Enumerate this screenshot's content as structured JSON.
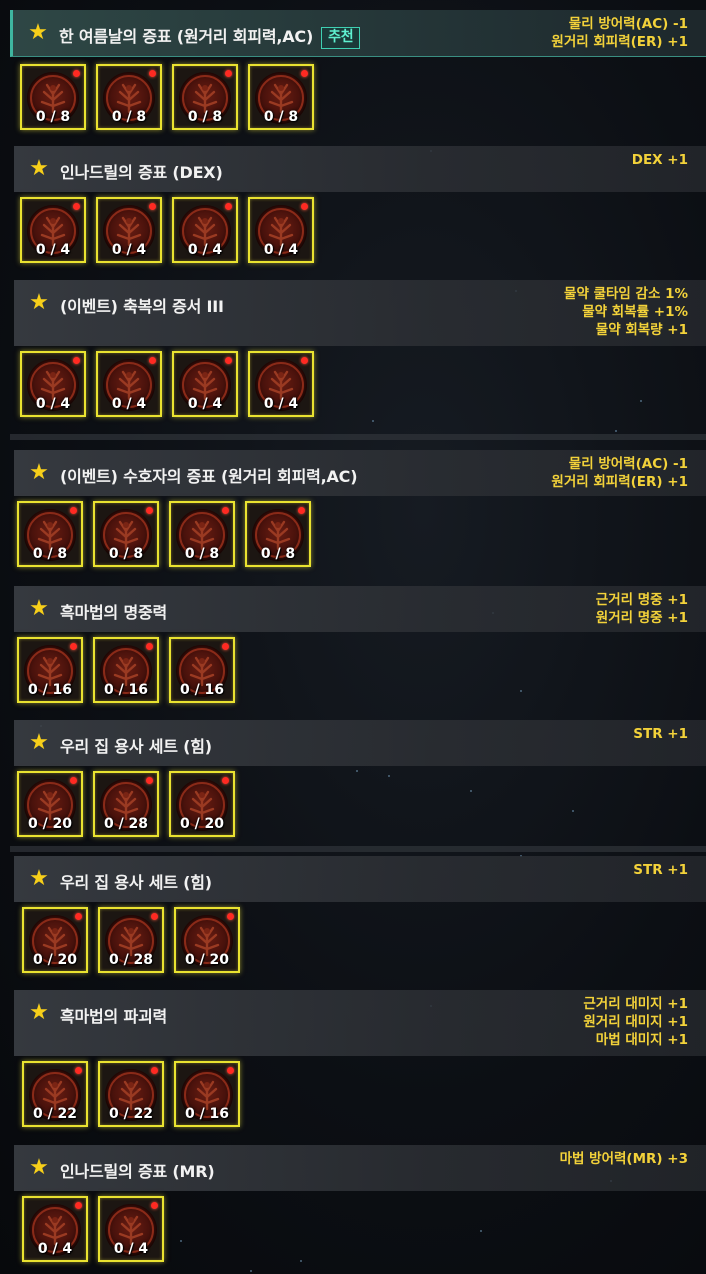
{
  "colors": {
    "accent_yellow": "#f3d23a",
    "slot_border": "#e9e230",
    "badge_teal": "#3fd0b2",
    "alert_dot": "#ff2a22"
  },
  "sections": [
    {
      "title": "한 여름날의 증표 (원거리 회피력,AC)",
      "badge": "추천",
      "stats": [
        "물리 방어력(AC) -1",
        "원거리 회피력(ER) +1"
      ],
      "slots": [
        "0 / 8",
        "0 / 8",
        "0 / 8",
        "0 / 8"
      ]
    },
    {
      "title": "인나드릴의 증표 (DEX)",
      "stats": [
        "DEX +1"
      ],
      "slots": [
        "0 / 4",
        "0 / 4",
        "0 / 4",
        "0 / 4"
      ]
    },
    {
      "title": "(이벤트) 축복의 증서 III",
      "stats": [
        "물약 쿨타임 감소 1%",
        "물약 회복률 +1%",
        "물약 회복량 +1"
      ],
      "slots": [
        "0 / 4",
        "0 / 4",
        "0 / 4",
        "0 / 4"
      ]
    },
    {
      "title": "(이벤트) 수호자의 증표 (원거리 회피력,AC)",
      "stats": [
        "물리 방어력(AC) -1",
        "원거리 회피력(ER) +1"
      ],
      "slots": [
        "0 / 8",
        "0 / 8",
        "0 / 8",
        "0 / 8"
      ]
    },
    {
      "title": "흑마법의 명중력",
      "stats": [
        "근거리 명중 +1",
        "원거리 명중 +1"
      ],
      "slots": [
        "0 / 16",
        "0 / 16",
        "0 / 16"
      ]
    },
    {
      "title": "우리 집 용사 세트 (힘)",
      "stats": [
        "STR +1"
      ],
      "slots": [
        "0 / 20",
        "0 / 28",
        "0 / 20"
      ]
    },
    {
      "title": "우리 집 용사 세트 (힘)",
      "stats": [
        "STR +1"
      ],
      "slots": [
        "0 / 20",
        "0 / 28",
        "0 / 20"
      ]
    },
    {
      "title": "흑마법의 파괴력",
      "stats": [
        "근거리 대미지 +1",
        "원거리 대미지 +1",
        "마법 대미지 +1"
      ],
      "slots": [
        "0 / 22",
        "0 / 22",
        "0 / 16"
      ]
    },
    {
      "title": "인나드릴의 증표 (MR)",
      "stats": [
        "마법 방어력(MR) +3"
      ],
      "slots": [
        "0 / 4",
        "0 / 4"
      ]
    }
  ]
}
